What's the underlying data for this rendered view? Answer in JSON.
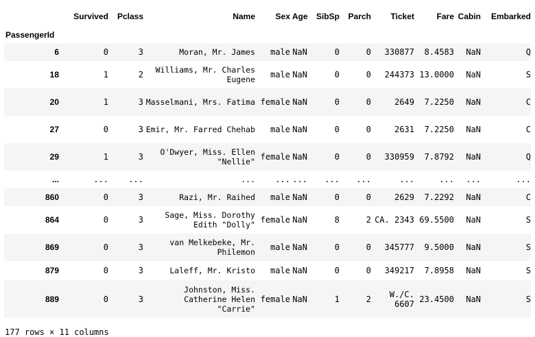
{
  "columns": [
    "Survived",
    "Pclass",
    "Name",
    "Sex",
    "Age",
    "SibSp",
    "Parch",
    "Ticket",
    "Fare",
    "Cabin",
    "Embarked"
  ],
  "index_name": "PassengerId",
  "rows": [
    {
      "id": "6",
      "cells": [
        "0",
        "3",
        "Moran, Mr. James",
        "male",
        "NaN",
        "0",
        "0",
        "330877",
        "8.4583",
        "NaN",
        "Q"
      ]
    },
    {
      "id": "18",
      "cells": [
        "1",
        "2",
        "Williams, Mr. Charles Eugene",
        "male",
        "NaN",
        "0",
        "0",
        "244373",
        "13.0000",
        "NaN",
        "S"
      ]
    },
    {
      "id": "20",
      "cells": [
        "1",
        "3",
        "Masselmani, Mrs. Fatima",
        "female",
        "NaN",
        "0",
        "0",
        "2649",
        "7.2250",
        "NaN",
        "C"
      ]
    },
    {
      "id": "27",
      "cells": [
        "0",
        "3",
        "Emir, Mr. Farred Chehab",
        "male",
        "NaN",
        "0",
        "0",
        "2631",
        "7.2250",
        "NaN",
        "C"
      ]
    },
    {
      "id": "29",
      "cells": [
        "1",
        "3",
        "O'Dwyer, Miss. Ellen \"Nellie\"",
        "female",
        "NaN",
        "0",
        "0",
        "330959",
        "7.8792",
        "NaN",
        "Q"
      ]
    },
    {
      "id": "...",
      "cells": [
        "...",
        "...",
        "...",
        "...",
        "...",
        "...",
        "...",
        "...",
        "...",
        "...",
        "..."
      ]
    },
    {
      "id": "860",
      "cells": [
        "0",
        "3",
        "Razi, Mr. Raihed",
        "male",
        "NaN",
        "0",
        "0",
        "2629",
        "7.2292",
        "NaN",
        "C"
      ]
    },
    {
      "id": "864",
      "cells": [
        "0",
        "3",
        "Sage, Miss. Dorothy Edith \"Dolly\"",
        "female",
        "NaN",
        "8",
        "2",
        "CA. 2343",
        "69.5500",
        "NaN",
        "S"
      ]
    },
    {
      "id": "869",
      "cells": [
        "0",
        "3",
        "van Melkebeke, Mr. Philemon",
        "male",
        "NaN",
        "0",
        "0",
        "345777",
        "9.5000",
        "NaN",
        "S"
      ]
    },
    {
      "id": "879",
      "cells": [
        "0",
        "3",
        "Laleff, Mr. Kristo",
        "male",
        "NaN",
        "0",
        "0",
        "349217",
        "7.8958",
        "NaN",
        "S"
      ]
    },
    {
      "id": "889",
      "cells": [
        "0",
        "3",
        "Johnston, Miss. Catherine Helen \"Carrie\"",
        "female",
        "NaN",
        "1",
        "2",
        "W./C. 6607",
        "23.4500",
        "NaN",
        "S"
      ]
    }
  ],
  "footer": "177 rows × 11 columns"
}
